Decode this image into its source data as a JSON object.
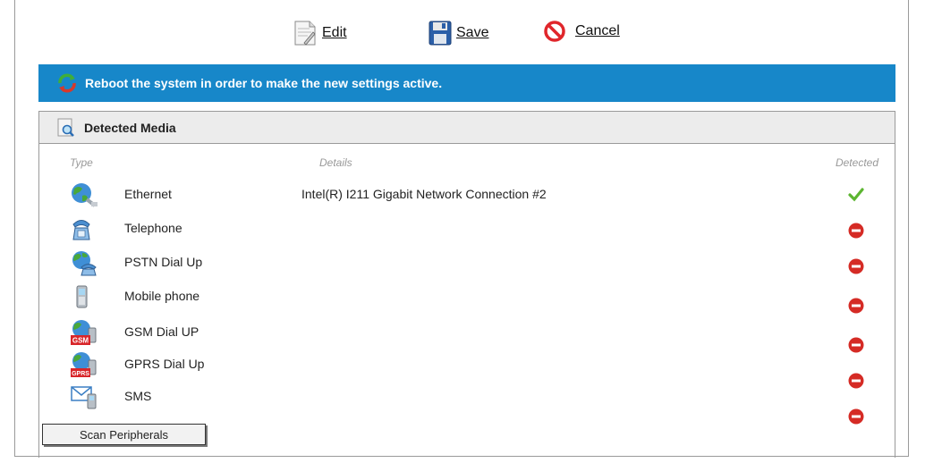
{
  "toolbar": {
    "edit_label": "Edit",
    "save_label": "Save",
    "cancel_label": "Cancel"
  },
  "banner": {
    "message": "Reboot the system in order to make the new settings active.",
    "color": "#1787c9"
  },
  "panel": {
    "title": "Detected Media",
    "columns": {
      "type": "Type",
      "details": "Details",
      "detected": "Detected"
    },
    "rows": [
      {
        "type": "Ethernet",
        "details": "Intel(R) I211 Gigabit Network Connection #2",
        "icon": "globe-cable-icon",
        "detected": true
      },
      {
        "type": "Telephone",
        "details": "",
        "icon": "telephone-icon",
        "detected": false
      },
      {
        "type": "PSTN Dial Up",
        "details": "",
        "icon": "globe-phone-icon",
        "detected": false
      },
      {
        "type": "Mobile phone",
        "details": "",
        "icon": "mobile-phone-icon",
        "detected": false
      },
      {
        "type": "GSM Dial UP",
        "details": "",
        "icon": "gsm-icon",
        "detected": false
      },
      {
        "type": "GPRS Dial Up",
        "details": "",
        "icon": "gprs-icon",
        "detected": false
      },
      {
        "type": "SMS",
        "details": "",
        "icon": "sms-icon",
        "detected": false
      }
    ],
    "icon_badges": {
      "gsm": "GSM",
      "gprs": "GPRS"
    },
    "extra_status_detected": false
  },
  "scan_button_label": "Scan Peripherals",
  "colors": {
    "check": "#5cb531",
    "no_entry": "#d52b25"
  }
}
